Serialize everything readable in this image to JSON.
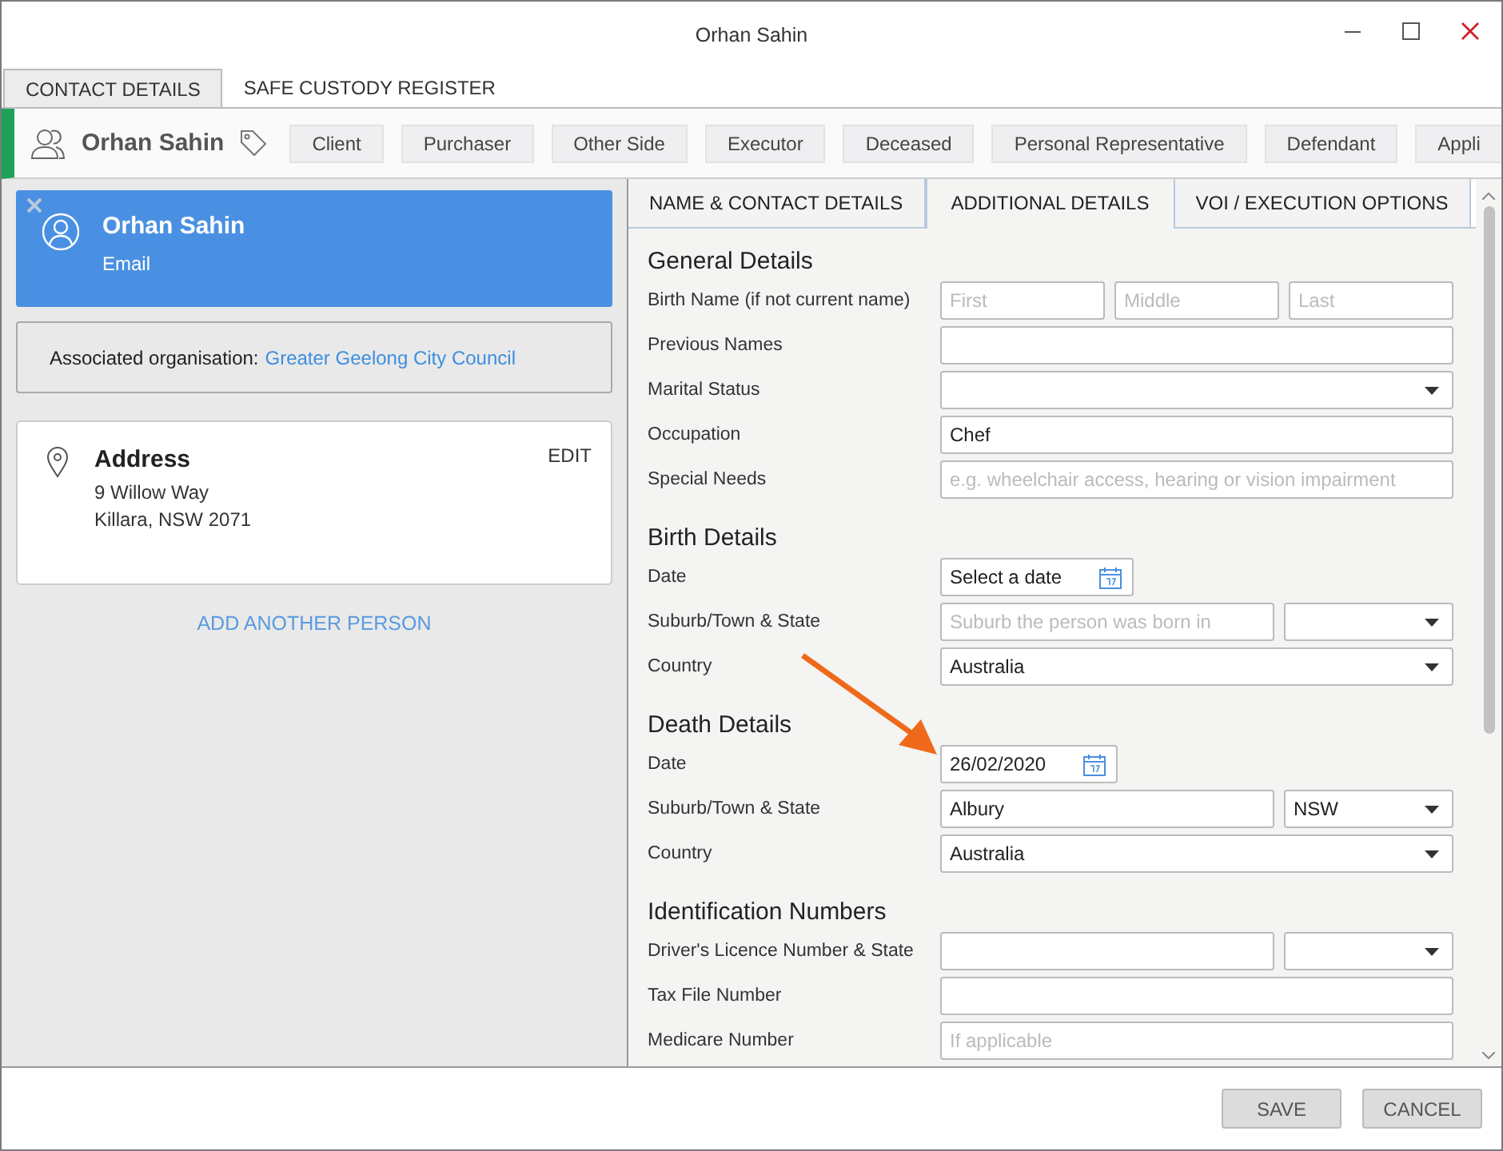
{
  "window": {
    "title": "Orhan Sahin"
  },
  "tabs": [
    {
      "label": "CONTACT DETAILS",
      "selected": true
    },
    {
      "label": "SAFE CUSTODY REGISTER",
      "selected": false
    }
  ],
  "header": {
    "name": "Orhan Sahin",
    "roles": [
      "Client",
      "Purchaser",
      "Other Side",
      "Executor",
      "Deceased",
      "Personal Representative",
      "Defendant",
      "Appli"
    ]
  },
  "person_card": {
    "name": "Orhan Sahin",
    "subtitle": "Email"
  },
  "organisation": {
    "label": "Associated organisation:",
    "link": "Greater Geelong City Council"
  },
  "address_card": {
    "title": "Address",
    "lines": [
      "9 Willow Way",
      "Killara, NSW 2071"
    ],
    "action": "EDIT"
  },
  "add_person": "ADD ANOTHER PERSON",
  "form_tabs": [
    {
      "label": "NAME & CONTACT DETAILS",
      "selected": false
    },
    {
      "label": "ADDITIONAL DETAILS",
      "selected": true
    },
    {
      "label": "VOI / EXECUTION OPTIONS",
      "selected": false
    }
  ],
  "sections": [
    {
      "title": "General Details",
      "rows": [
        {
          "label": "Birth Name (if not current name)",
          "fields": [
            {
              "kind": "text",
              "placeholder": "First"
            },
            {
              "kind": "text",
              "placeholder": "Middle"
            },
            {
              "kind": "text",
              "placeholder": "Last"
            }
          ]
        },
        {
          "label": "Previous Names",
          "fields": [
            {
              "kind": "text"
            }
          ]
        },
        {
          "label": "Marital Status",
          "fields": [
            {
              "kind": "select"
            }
          ]
        },
        {
          "label": "Occupation",
          "fields": [
            {
              "kind": "text",
              "value": "Chef"
            }
          ]
        },
        {
          "label": "Special Needs",
          "fields": [
            {
              "kind": "text",
              "placeholder": "e.g. wheelchair access, hearing or vision impairment"
            }
          ]
        }
      ]
    },
    {
      "title": "Birth Details",
      "rows": [
        {
          "label": "Date",
          "fields": [
            {
              "kind": "date",
              "value": "Select a date"
            }
          ]
        },
        {
          "label": "Suburb/Town & State",
          "fields": [
            {
              "kind": "text",
              "placeholder": "Suburb the person was born in"
            },
            {
              "kind": "select"
            }
          ]
        },
        {
          "label": "Country",
          "fields": [
            {
              "kind": "select",
              "value": "Australia"
            }
          ]
        }
      ]
    },
    {
      "title": "Death Details",
      "rows": [
        {
          "label": "Date",
          "fields": [
            {
              "kind": "date",
              "value": "26/02/2020"
            }
          ]
        },
        {
          "label": "Suburb/Town & State",
          "fields": [
            {
              "kind": "text",
              "value": "Albury"
            },
            {
              "kind": "select",
              "value": "NSW"
            }
          ]
        },
        {
          "label": "Country",
          "fields": [
            {
              "kind": "select",
              "value": "Australia"
            }
          ]
        }
      ]
    },
    {
      "title": "Identification Numbers",
      "rows": [
        {
          "label": "Driver's Licence Number & State",
          "fields": [
            {
              "kind": "text"
            },
            {
              "kind": "select"
            }
          ]
        },
        {
          "label": "Tax File Number",
          "fields": [
            {
              "kind": "text"
            }
          ]
        },
        {
          "label": "Medicare Number",
          "fields": [
            {
              "kind": "text",
              "placeholder": "If applicable"
            }
          ]
        }
      ]
    }
  ],
  "buttons": [
    "SAVE",
    "CANCEL"
  ]
}
